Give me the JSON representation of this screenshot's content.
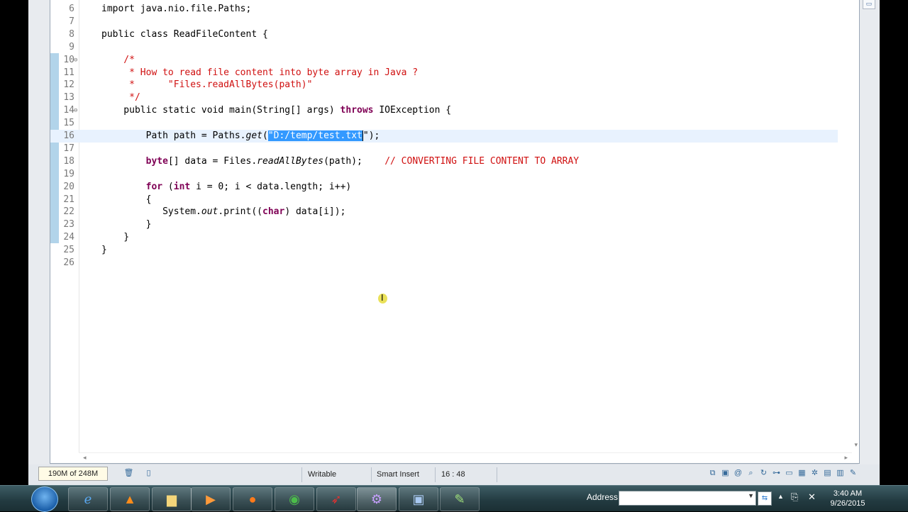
{
  "editor": {
    "lines": [
      {
        "num": "6",
        "segs": [
          {
            "t": "import java.nio.file.Paths;",
            "c": ""
          }
        ]
      },
      {
        "num": "7",
        "segs": []
      },
      {
        "num": "8",
        "segs": [
          {
            "t": "public class ReadFileContent {",
            "c": ""
          }
        ]
      },
      {
        "num": "9",
        "segs": []
      },
      {
        "num": "10",
        "fold": "⊖",
        "segs": [
          {
            "t": "    /*",
            "c": "cm"
          }
        ]
      },
      {
        "num": "11",
        "segs": [
          {
            "t": "     * How to read file content into byte array in Java ?",
            "c": "cm"
          }
        ]
      },
      {
        "num": "12",
        "segs": [
          {
            "t": "     *      \"Files.readAllBytes(path)\"",
            "c": "cm"
          }
        ]
      },
      {
        "num": "13",
        "segs": [
          {
            "t": "     */",
            "c": "cm"
          }
        ]
      },
      {
        "num": "14",
        "fold": "⊖",
        "segs": [
          {
            "t": "    public static void main(String[] args) ",
            "c": ""
          },
          {
            "t": "throws",
            "c": "kw"
          },
          {
            "t": " IOException {",
            "c": ""
          }
        ]
      },
      {
        "num": "15",
        "segs": []
      },
      {
        "num": "16",
        "current": true,
        "segs": [
          {
            "t": "        Path path = Paths.",
            "c": ""
          },
          {
            "t": "get",
            "c": "it"
          },
          {
            "t": "(",
            "c": ""
          },
          {
            "t": "\"D:/temp/test.txt",
            "c": "sel"
          },
          {
            "t": "\");",
            "c": "caret"
          }
        ]
      },
      {
        "num": "17",
        "segs": []
      },
      {
        "num": "18",
        "segs": [
          {
            "t": "        ",
            "c": ""
          },
          {
            "t": "byte",
            "c": "kw"
          },
          {
            "t": "[] data = Files.",
            "c": ""
          },
          {
            "t": "readAllBytes",
            "c": "it"
          },
          {
            "t": "(path);    ",
            "c": ""
          },
          {
            "t": "// CONVERTING FILE CONTENT TO ARRAY",
            "c": "cm"
          }
        ]
      },
      {
        "num": "19",
        "segs": []
      },
      {
        "num": "20",
        "segs": [
          {
            "t": "        ",
            "c": ""
          },
          {
            "t": "for",
            "c": "kw"
          },
          {
            "t": " (",
            "c": ""
          },
          {
            "t": "int",
            "c": "kw"
          },
          {
            "t": " i = 0; i < data.length; i++)",
            "c": ""
          }
        ]
      },
      {
        "num": "21",
        "segs": [
          {
            "t": "        {",
            "c": ""
          }
        ]
      },
      {
        "num": "22",
        "segs": [
          {
            "t": "           System.",
            "c": ""
          },
          {
            "t": "out",
            "c": "it"
          },
          {
            "t": ".print((",
            "c": ""
          },
          {
            "t": "char",
            "c": "kw"
          },
          {
            "t": ") data[i]);",
            "c": ""
          }
        ]
      },
      {
        "num": "23",
        "segs": [
          {
            "t": "        }",
            "c": ""
          }
        ]
      },
      {
        "num": "24",
        "segs": [
          {
            "t": "    }",
            "c": ""
          }
        ]
      },
      {
        "num": "25",
        "segs": [
          {
            "t": "}",
            "c": ""
          }
        ]
      },
      {
        "num": "26",
        "segs": []
      }
    ]
  },
  "status": {
    "heap": "190M of 248M",
    "writable": "Writable",
    "insert_mode": "Smart Insert",
    "position": "16 : 48"
  },
  "taskbar": {
    "address_label": "Address",
    "time": "3:40 AM",
    "date": "9/26/2015"
  }
}
